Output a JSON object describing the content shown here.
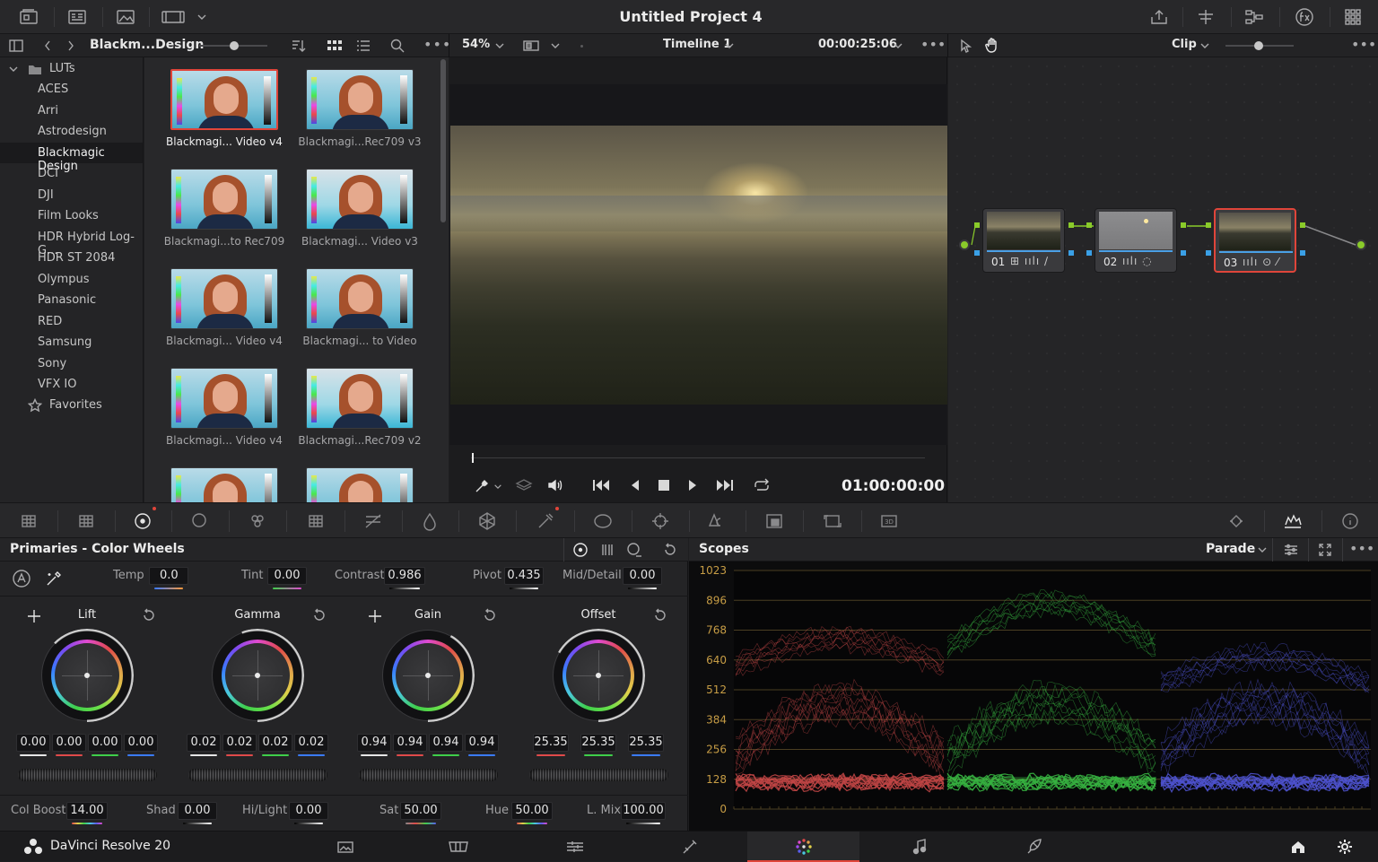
{
  "app": {
    "title": "Untitled Project 4",
    "name": "DaVinci Resolve 20"
  },
  "media": {
    "path": "Blackm...Design",
    "zoom": "54%",
    "timeline": "Timeline 1",
    "timecode": "00:00:25:06",
    "playhead_tc": "01:00:00:00"
  },
  "lut_tree": {
    "root": "LUTs",
    "items": [
      "ACES",
      "Arri",
      "Astrodesign",
      "Blackmagic Design",
      "DCI",
      "DJI",
      "Film Looks",
      "HDR Hybrid Log-G...",
      "HDR ST 2084",
      "Olympus",
      "Panasonic",
      "RED",
      "Samsung",
      "Sony",
      "VFX IO"
    ],
    "selected": "Blackmagic Design",
    "favorites": "Favorites"
  },
  "thumbs": [
    "Blackmagi... Video v4",
    "Blackmagi...Rec709 v3",
    "Blackmagi...to Rec709",
    "Blackmagi... Video v3",
    "Blackmagi... Video v4",
    "Blackmagi... to Video",
    "Blackmagi... Video v4",
    "Blackmagi...Rec709 v2"
  ],
  "nodes": {
    "mode": "Clip",
    "items": [
      "01",
      "02",
      "03"
    ]
  },
  "primaries": {
    "title": "Primaries - Color Wheels",
    "temp_label": "Temp",
    "temp": "0.0",
    "tint_label": "Tint",
    "tint": "0.00",
    "contrast_label": "Contrast",
    "contrast": "0.986",
    "pivot_label": "Pivot",
    "pivot": "0.435",
    "md_label": "Mid/Detail",
    "md": "0.00",
    "wheels": [
      {
        "name": "Lift",
        "values": [
          "0.00",
          "0.00",
          "0.00",
          "0.00"
        ]
      },
      {
        "name": "Gamma",
        "values": [
          "0.02",
          "0.02",
          "0.02",
          "0.02"
        ]
      },
      {
        "name": "Gain",
        "values": [
          "0.94",
          "0.94",
          "0.94",
          "0.94"
        ]
      },
      {
        "name": "Offset",
        "values": [
          "25.35",
          "25.35",
          "25.35"
        ]
      }
    ],
    "colboost_label": "Col Boost",
    "colboost": "14.00",
    "shad_label": "Shad",
    "shad": "0.00",
    "hilight_label": "Hi/Light",
    "hilight": "0.00",
    "sat_label": "Sat",
    "sat": "50.00",
    "hue_label": "Hue",
    "hue": "50.00",
    "lmix_label": "L. Mix",
    "lmix": "100.00"
  },
  "scopes": {
    "title": "Scopes",
    "mode": "Parade",
    "ticks": [
      "1023",
      "896",
      "768",
      "640",
      "512",
      "384",
      "256",
      "128",
      "0"
    ]
  },
  "colors": {
    "accent": "#e0453a",
    "red": "#e05050",
    "green": "#3fcf4a",
    "blue": "#5a5ff0",
    "label": "#c79d45"
  }
}
